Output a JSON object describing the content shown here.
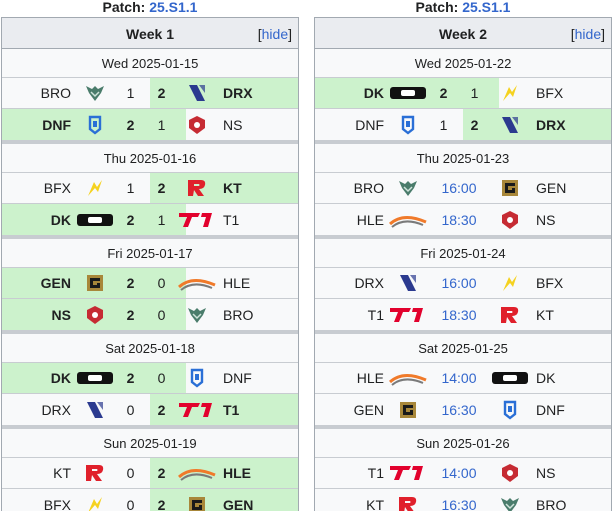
{
  "columns": [
    {
      "patch_label": "Patch:",
      "patch_value": "25.S1.1",
      "week_title": "Week 1",
      "hide_label": "hide",
      "days": [
        {
          "date": "Wed 2025-01-15",
          "matches": [
            {
              "left": "BRO",
              "left_logo": "bro-logo",
              "s1": "1",
              "s2": "2",
              "right": "DRX",
              "right_logo": "drx-logo",
              "winner": "right"
            },
            {
              "left": "DNF",
              "left_logo": "dnf-logo",
              "s1": "2",
              "s2": "1",
              "right": "NS",
              "right_logo": "ns-logo",
              "winner": "left"
            }
          ]
        },
        {
          "date": "Thu 2025-01-16",
          "matches": [
            {
              "left": "BFX",
              "left_logo": "bfx-logo",
              "s1": "1",
              "s2": "2",
              "right": "KT",
              "right_logo": "kt-logo",
              "winner": "right"
            },
            {
              "left": "DK",
              "left_logo": "dk-logo",
              "s1": "2",
              "s2": "1",
              "right": "T1",
              "right_logo": "t1-logo",
              "winner": "left"
            }
          ]
        },
        {
          "date": "Fri 2025-01-17",
          "matches": [
            {
              "left": "GEN",
              "left_logo": "gen-logo",
              "s1": "2",
              "s2": "0",
              "right": "HLE",
              "right_logo": "hle-logo",
              "winner": "left"
            },
            {
              "left": "NS",
              "left_logo": "ns-logo",
              "s1": "2",
              "s2": "0",
              "right": "BRO",
              "right_logo": "bro-logo",
              "winner": "left"
            }
          ]
        },
        {
          "date": "Sat 2025-01-18",
          "matches": [
            {
              "left": "DK",
              "left_logo": "dk-logo",
              "s1": "2",
              "s2": "0",
              "right": "DNF",
              "right_logo": "dnf-logo",
              "winner": "left"
            },
            {
              "left": "DRX",
              "left_logo": "drx-logo",
              "s1": "0",
              "s2": "2",
              "right": "T1",
              "right_logo": "t1-logo",
              "winner": "right"
            }
          ]
        },
        {
          "date": "Sun 2025-01-19",
          "matches": [
            {
              "left": "KT",
              "left_logo": "kt-logo",
              "s1": "0",
              "s2": "2",
              "right": "HLE",
              "right_logo": "hle-logo",
              "winner": "right"
            },
            {
              "left": "BFX",
              "left_logo": "bfx-logo",
              "s1": "0",
              "s2": "2",
              "right": "GEN",
              "right_logo": "gen-logo",
              "winner": "right"
            }
          ]
        }
      ]
    },
    {
      "patch_label": "Patch:",
      "patch_value": "25.S1.1",
      "week_title": "Week 2",
      "hide_label": "hide",
      "days": [
        {
          "date": "Wed 2025-01-22",
          "matches": [
            {
              "left": "DK",
              "left_logo": "dk-logo",
              "s1": "2",
              "s2": "1",
              "right": "BFX",
              "right_logo": "bfx-logo",
              "winner": "left"
            },
            {
              "left": "DNF",
              "left_logo": "dnf-logo",
              "s1": "1",
              "s2": "2",
              "right": "DRX",
              "right_logo": "drx-logo",
              "winner": "right"
            }
          ]
        },
        {
          "date": "Thu 2025-01-23",
          "matches": [
            {
              "left": "BRO",
              "left_logo": "bro-logo",
              "time": "16:00",
              "right": "GEN",
              "right_logo": "gen-logo",
              "winner": "none"
            },
            {
              "left": "HLE",
              "left_logo": "hle-logo",
              "time": "18:30",
              "right": "NS",
              "right_logo": "ns-logo",
              "winner": "none"
            }
          ]
        },
        {
          "date": "Fri 2025-01-24",
          "matches": [
            {
              "left": "DRX",
              "left_logo": "drx-logo",
              "time": "16:00",
              "right": "BFX",
              "right_logo": "bfx-logo",
              "winner": "none"
            },
            {
              "left": "T1",
              "left_logo": "t1-logo",
              "time": "18:30",
              "right": "KT",
              "right_logo": "kt-logo",
              "winner": "none"
            }
          ]
        },
        {
          "date": "Sat 2025-01-25",
          "matches": [
            {
              "left": "HLE",
              "left_logo": "hle-logo",
              "time": "14:00",
              "right": "DK",
              "right_logo": "dk-logo",
              "winner": "none"
            },
            {
              "left": "GEN",
              "left_logo": "gen-logo",
              "time": "16:30",
              "right": "DNF",
              "right_logo": "dnf-logo",
              "winner": "none"
            }
          ]
        },
        {
          "date": "Sun 2025-01-26",
          "matches": [
            {
              "left": "T1",
              "left_logo": "t1-logo",
              "time": "14:00",
              "right": "NS",
              "right_logo": "ns-logo",
              "winner": "none"
            },
            {
              "left": "KT",
              "left_logo": "kt-logo",
              "time": "16:30",
              "right": "BRO",
              "right_logo": "bro-logo",
              "winner": "none"
            }
          ]
        }
      ]
    }
  ],
  "logo_colors": {
    "bro": "#4a7c6b",
    "drx": "#2b3a8f",
    "dnf": "#2a6fd6",
    "ns": "#c62b33",
    "bfx": "#f5d21f",
    "kt": "#e0202b",
    "dk": "#111111",
    "t1": "#e2012d",
    "gen": "#a8873a",
    "hle": "#f07a2a"
  }
}
